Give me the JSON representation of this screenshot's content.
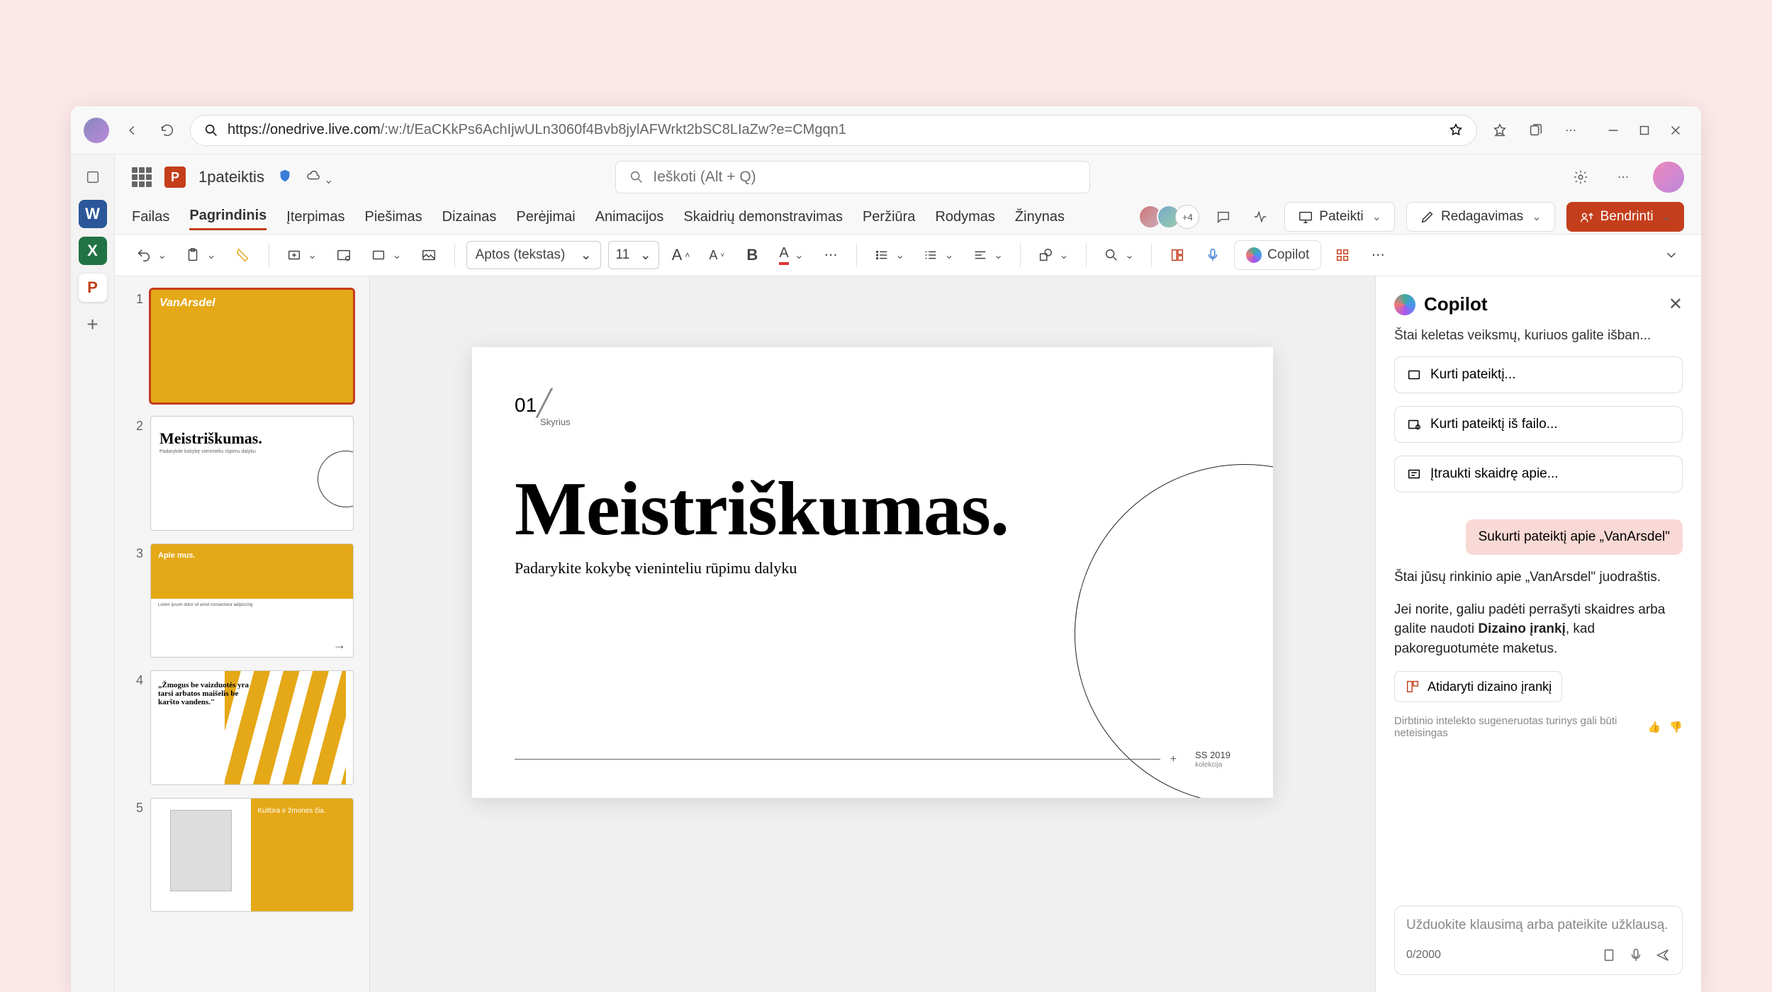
{
  "browser": {
    "url_host": "https://onedrive.live.com",
    "url_path": "/:w:/t/EaCKkPs6AchIjwULn3060f4Bvb8jylAFWrkt2bSC8LIaZw?e=CMgqn1"
  },
  "titlebar": {
    "doc_title": "1pateiktis",
    "search_placeholder": "Ieškoti (Alt + Q)"
  },
  "ribbon": {
    "tabs": [
      "Failas",
      "Pagrindinis",
      "Įterpimas",
      "Piešimas",
      "Dizainas",
      "Perėjimai",
      "Animacijos",
      "Skaidrių demonstravimas",
      "Peržiūra",
      "Rodymas",
      "Žinynas"
    ],
    "active_index": 1,
    "presence_more": "+4",
    "present_label": "Pateikti",
    "editing_label": "Redagavimas",
    "share_label": "Bendrinti"
  },
  "toolbar": {
    "font_name": "Aptos (tekstas)",
    "font_size": "11",
    "copilot_label": "Copilot"
  },
  "thumbnails": [
    {
      "n": "1",
      "kind": "yellow",
      "title": "VanArsdel"
    },
    {
      "n": "2",
      "kind": "meist",
      "title": "Meistriškumas.",
      "sub": "Padarykite kokybę vieninteliu rūpimu dalyku"
    },
    {
      "n": "3",
      "kind": "about",
      "title": "Apie mus."
    },
    {
      "n": "4",
      "kind": "quote",
      "quote": "„Žmogus be vaizduotės yra tarsi arbatos maišelis be karšto vandens.\""
    },
    {
      "n": "5",
      "kind": "split",
      "title": "Kultūra ir žmonės čia."
    }
  ],
  "slide": {
    "num": "01",
    "section": "Skyrius",
    "title": "Meistriškumas.",
    "subtitle": "Padarykite kokybę vieninteliu rūpimu dalyku",
    "footer_year": "SS 2019",
    "footer_coll": "kolekcija"
  },
  "copilot": {
    "panel_title": "Copilot",
    "intro": "Štai keletas veiksmų, kuriuos galite išban...",
    "suggestions": [
      "Kurti pateiktį...",
      "Kurti pateiktį iš failo...",
      "Įtraukti skaidrę apie..."
    ],
    "user_msg": "Sukurti pateiktį apie „VanArsdel\"",
    "response_1": "Štai jūsų rinkinio apie „VanArsdel\" juodraštis.",
    "response_2a": "Jei norite, galiu padėti perrašyti skaidres arba galite naudoti ",
    "response_2b": "Dizaino įrankį",
    "response_2c": ", kad pakoreguotumėte maketus.",
    "action_label": "Atidaryti dizaino įrankį",
    "disclaimer": "Dirbtinio intelekto sugeneruotas turinys gali būti neteisingas",
    "input_placeholder": "Užduokite klausimą arba pateikite užklausą.",
    "char_count": "0/2000"
  }
}
